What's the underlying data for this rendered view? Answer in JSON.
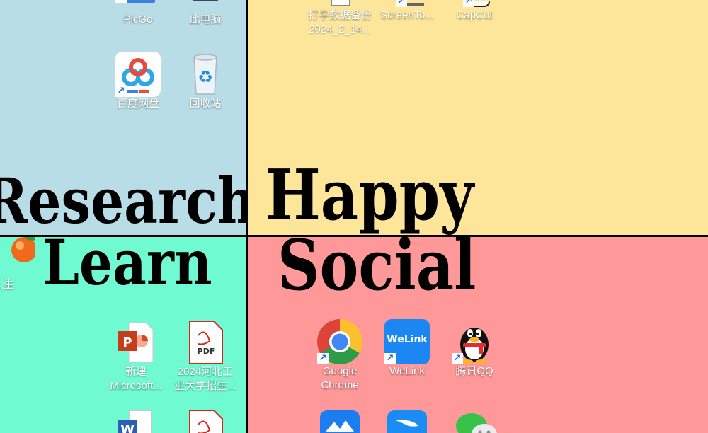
{
  "quadrants": {
    "research": {
      "label": "Research",
      "color": "#b8dde6"
    },
    "happy": {
      "label": "Happy",
      "color": "#fde69a"
    },
    "learn": {
      "label": "Learn",
      "color": "#6ffad2"
    },
    "social": {
      "label": "Social",
      "color": "#ff9898"
    }
  },
  "icons": {
    "picgo": {
      "label": "PicGo"
    },
    "this_pc": {
      "label": "此电脑"
    },
    "baidu": {
      "label": "百度网盘"
    },
    "recycle": {
      "label": "回收站"
    },
    "backup": {
      "line1": "打字数据备份",
      "line2": "2024_2_14..."
    },
    "screento": {
      "label": "ScreenTo..."
    },
    "capcut": {
      "label": "CapCut"
    },
    "partial_learn": {
      "label": "你人生"
    },
    "ppt": {
      "line1": "新建",
      "line2": "Microsoft..."
    },
    "pdf1": {
      "line1": "2024河北工",
      "line2": "业大学招生...",
      "badge": "PDF"
    },
    "chrome": {
      "line1": "Google",
      "line2": "Chrome"
    },
    "welink": {
      "label": "WeLink",
      "logo": "WeLink"
    },
    "qq": {
      "label": "腾讯QQ"
    },
    "word": {
      "badge": "W"
    }
  }
}
